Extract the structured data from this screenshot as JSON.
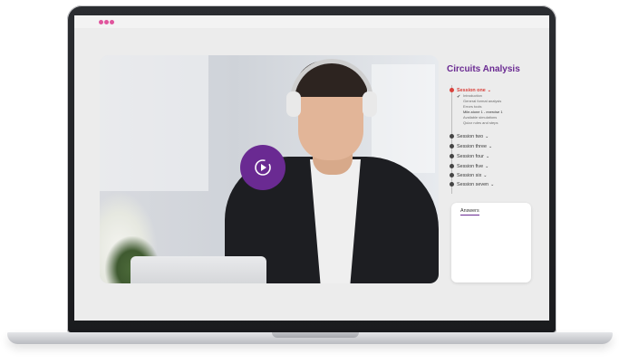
{
  "topbar": {
    "dots": [
      "#e0559d",
      "#e0559d",
      "#e0559d"
    ]
  },
  "video": {
    "play_icon": "play-circle-icon",
    "accent": "#6a2a92"
  },
  "course": {
    "title": "Circuits Analysis"
  },
  "sessions": {
    "active": {
      "label": "Session one",
      "chevron": "⌄"
    },
    "lessons": [
      "Introduction",
      "General format analysis",
      "Errors tools",
      "Mile-stone 1 - exercise 1",
      "Available simulations",
      "Quizz rules and steps"
    ],
    "items": [
      {
        "label": "Session two",
        "chevron": "⌄"
      },
      {
        "label": "Session three",
        "chevron": "⌄"
      },
      {
        "label": "Session four",
        "chevron": "⌄"
      },
      {
        "label": "Session five",
        "chevron": "⌄"
      },
      {
        "label": "Session six",
        "chevron": "⌄"
      },
      {
        "label": "Session seven",
        "chevron": "⌄"
      }
    ]
  },
  "answers": {
    "label": "Answers"
  },
  "colors": {
    "accent": "#6a2a92",
    "active": "#d9413b",
    "screen_bg": "#ececec"
  }
}
